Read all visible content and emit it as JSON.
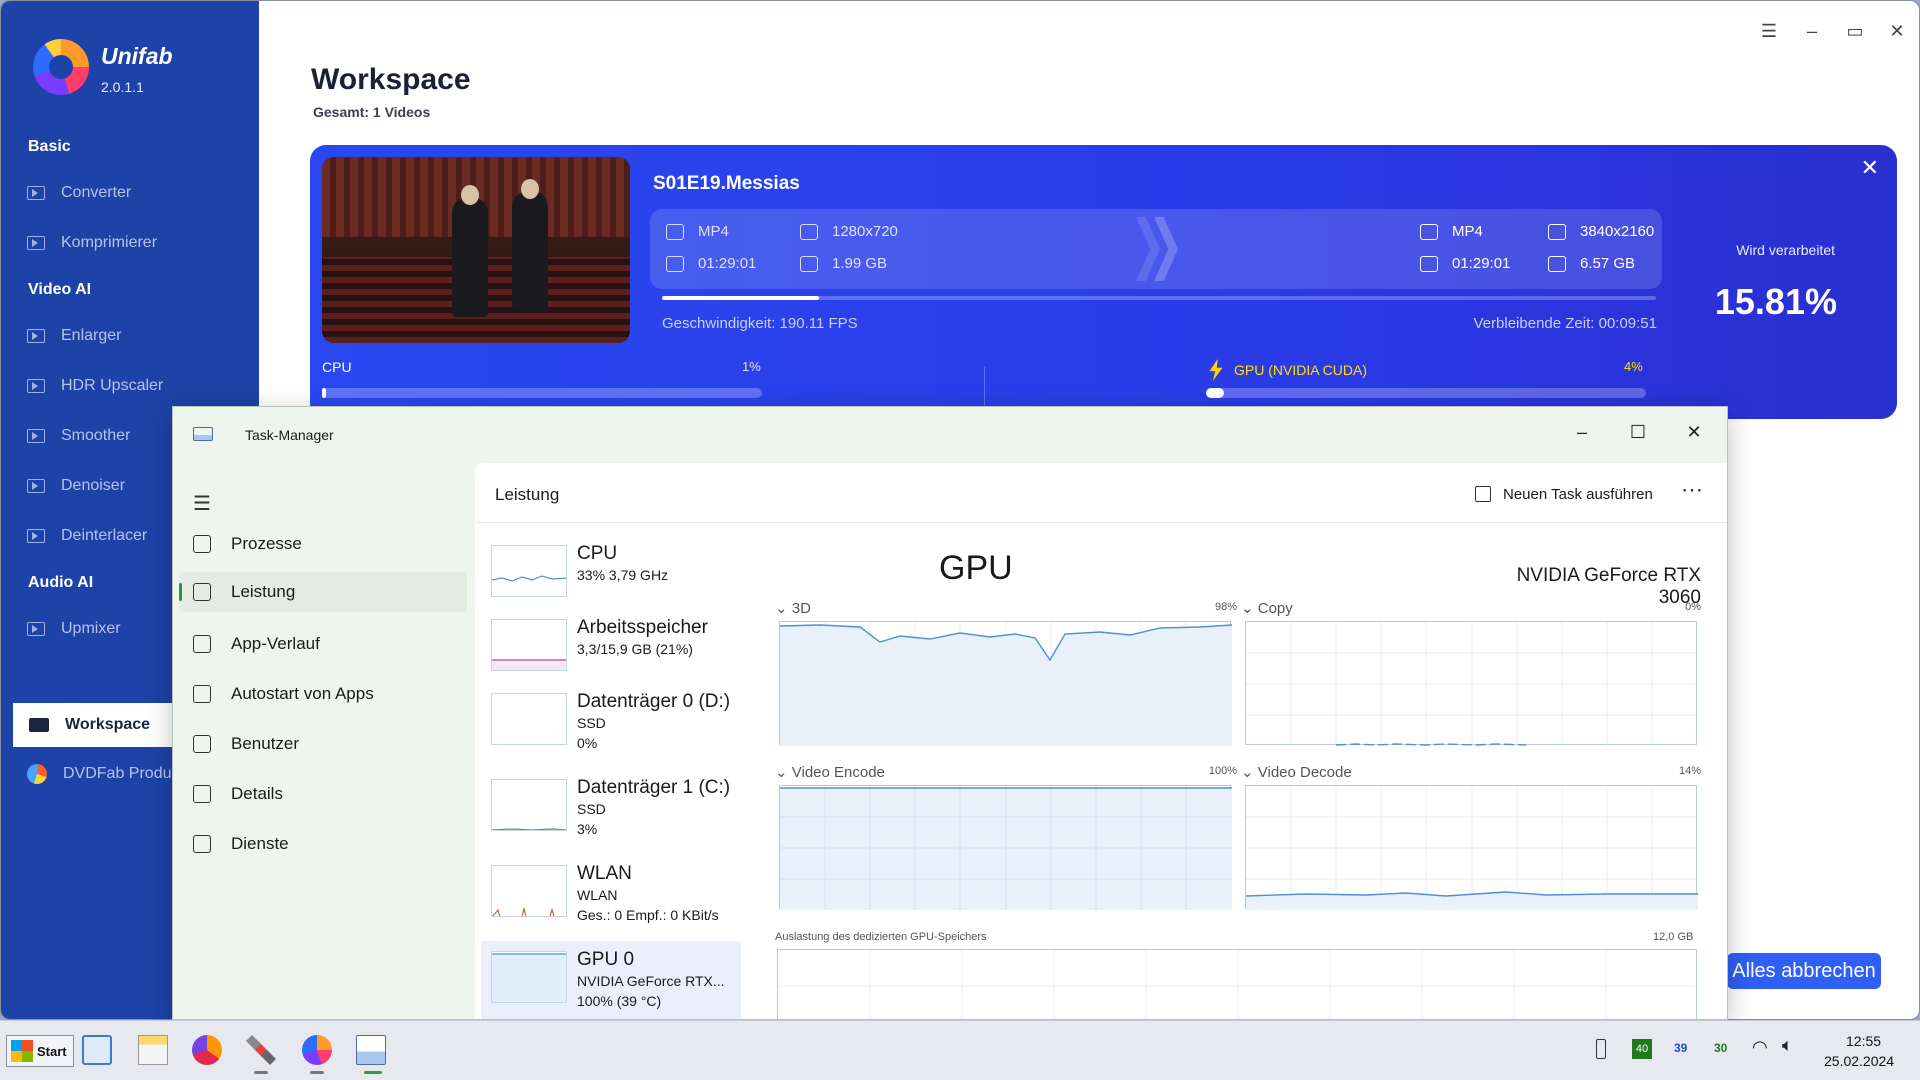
{
  "unifab": {
    "brand": "Unifab",
    "version": "2.0.1.1",
    "sections": {
      "basic": "Basic",
      "video_ai": "Video AI",
      "audio_ai": "Audio AI"
    },
    "items": {
      "converter": "Converter",
      "compressor": "Komprimierer",
      "enlarger": "Enlarger",
      "hdr": "HDR Upscaler",
      "smoother": "Smoother",
      "denoiser": "Denoiser",
      "deinterlacer": "Deinterlacer",
      "upmixer": "Upmixer",
      "workspace": "Workspace",
      "dvdfab": "DVDFab Produ"
    },
    "page_title": "Workspace",
    "page_subtitle": "Gesamt: 1 Videos",
    "job": {
      "name": "S01E19.Messias",
      "input": {
        "format": "MP4",
        "resolution": "1280x720",
        "duration": "01:29:01",
        "size": "1.99 GB"
      },
      "output": {
        "format": "MP4",
        "resolution": "3840x2160",
        "duration": "01:29:01",
        "size": "6.57 GB"
      },
      "progress": 0.1581,
      "speed": "Geschwindigkeit: 190.11  FPS",
      "remaining": "Verbleibende Zeit: 00:09:51",
      "status": "Wird verarbeitet",
      "percent": "15.81%",
      "cpu_label": "CPU",
      "cpu_pct": "1%",
      "cpu_value": 0.01,
      "gpu_label": "GPU (NVIDIA CUDA)",
      "gpu_pct": "4%",
      "gpu_value": 0.04
    },
    "cancel_all": "Alles abbrechen"
  },
  "taskmanager": {
    "title": "Task-Manager",
    "nav": {
      "processes": "Prozesse",
      "performance": "Leistung",
      "app_history": "App-Verlauf",
      "autostart": "Autostart von Apps",
      "users": "Benutzer",
      "details": "Details",
      "services": "Dienste"
    },
    "header_title": "Leistung",
    "new_task": "Neuen Task ausführen",
    "perf": {
      "cpu": {
        "name": "CPU",
        "l2": "33%  3,79 GHz",
        "l3": ""
      },
      "mem": {
        "name": "Arbeitsspeicher",
        "l2": "3,3/15,9 GB (21%)",
        "l3": ""
      },
      "disk0": {
        "name": "Datenträger 0 (D:)",
        "l2": "SSD",
        "l3": "0%"
      },
      "disk1": {
        "name": "Datenträger 1 (C:)",
        "l2": "SSD",
        "l3": "3%"
      },
      "wlan": {
        "name": "WLAN",
        "l2": "WLAN",
        "l3": "Ges.: 0  Empf.: 0 KBit/s"
      },
      "gpu0": {
        "name": "GPU 0",
        "l2": "NVIDIA GeForce RTX...",
        "l3": "100%  (39 °C)"
      }
    },
    "gpu_title": "GPU",
    "gpu_model": "NVIDIA GeForce RTX 3060",
    "graphs": {
      "g3d": {
        "label": "3D",
        "pct": "98%"
      },
      "copy": {
        "label": "Copy",
        "pct": "0%"
      },
      "venc": {
        "label": "Video Encode",
        "pct": "100%"
      },
      "vdec": {
        "label": "Video Decode",
        "pct": "14%"
      }
    },
    "mem_label": "Auslastung des dedizierten GPU-Speichers",
    "mem_max": "12,0 GB"
  },
  "taskbar": {
    "start": "Start",
    "tray_a": "40",
    "tray_b": "39",
    "tray_c": "30",
    "time": "12:55",
    "date": "25.02.2024"
  },
  "colors": {
    "sidebar": "#1d43a8",
    "card": "#2a3be8",
    "accent": "#2f5ff5",
    "gpu_yellow": "#ffe100",
    "tm_graph": "#4f8fd6"
  }
}
